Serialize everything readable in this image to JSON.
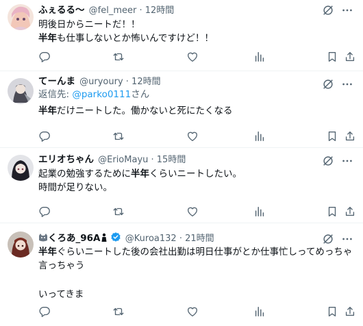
{
  "tweets": [
    {
      "name": "ふぇるる〜",
      "handle": "@fel_meer · 12時間",
      "lines": [
        "明後日からニートだ！！",
        "半年も仕事しないとか怖いんですけど！！"
      ],
      "bold_prefix": [
        "",
        "半年"
      ],
      "rest": [
        "明後日からニートだ！！",
        "も仕事しないとか怖いんですけど！！"
      ]
    },
    {
      "name": "てーんま",
      "handle": "@uryoury · 12時間",
      "reply_prefix": "返信先: ",
      "reply_link": "@parko0111",
      "reply_suffix": "さん",
      "bold_prefix": [
        "半年"
      ],
      "rest": [
        "だけニートした。働かないと死にたくなる"
      ]
    },
    {
      "name": "エリオちゃん",
      "handle": "@ErioMayu · 15時間",
      "line1_a": "起業の勉強するために",
      "line1_b": "半年",
      "line1_c": "くらいニートしたい。",
      "line2": "時間が足りない。"
    },
    {
      "name": "くろあ_96A",
      "handle": "@Kuroa132 · 21時間",
      "bold_prefix": "半年",
      "line1_rest": "ぐらいニートした後の会社出勤は明日仕事がとか仕事忙しってめっちゃ",
      "line2": "言っちゃう",
      "line3": "いってきま"
    }
  ],
  "icons": [
    "reply-icon",
    "retweet-icon",
    "like-icon",
    "views-icon",
    "bookmark-icon",
    "share-icon",
    "grok-icon",
    "more-icon",
    "verified-icon"
  ],
  "colors": {
    "text": "#0f1419",
    "secondary": "#536471",
    "link": "#1d9bf0",
    "divider": "#eff3f4",
    "verified": "#1d9bf0"
  }
}
